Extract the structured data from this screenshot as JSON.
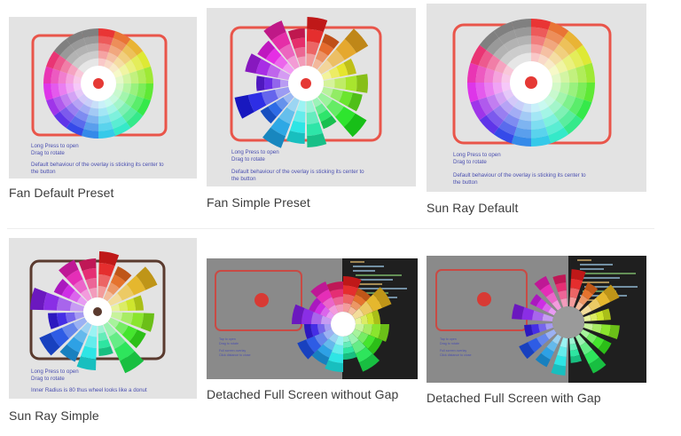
{
  "captions": {
    "fan_default": "Fan Default Preset",
    "fan_simple": "Fan Simple Preset",
    "sunray_default": "Sun Ray Default",
    "sunray_simple": "Sun Ray Simple",
    "detached_no_gap": "Detached Full Screen without Gap",
    "detached_gap": "Detached Full Screen with Gap"
  },
  "notes": {
    "open": "Long Press to open",
    "rotate": "Drag to rotate",
    "default_behaviour": "Default behaviour of the overlay is sticking its center to",
    "the_button": "the button",
    "inner_radius": "Inner Radius is 80 thus wheel looks like a donut"
  },
  "colors": {
    "screen_bg": "#e3e3e3",
    "frame_red": "#e9554a",
    "frame_brown": "#5a3a2e",
    "center_red": "#e53935",
    "dark_bg": "#1f1f1f",
    "grey_bg": "#8a8a8a"
  }
}
